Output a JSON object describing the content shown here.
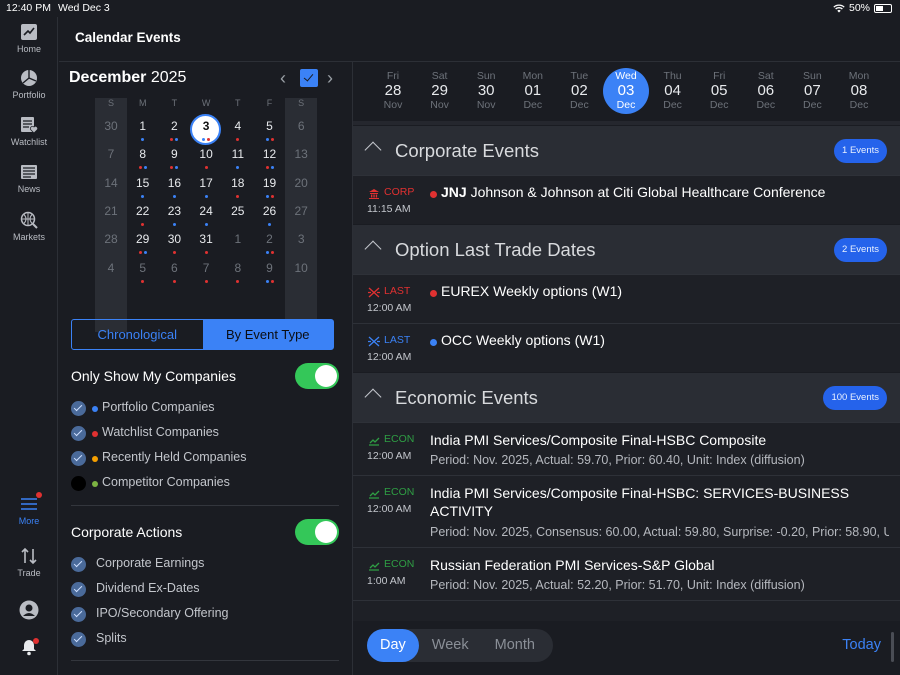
{
  "status": {
    "time": "12:40 PM",
    "date": "Wed Dec 3",
    "battery": "50%"
  },
  "nav": [
    {
      "label": "Home",
      "icon": "chart-icon"
    },
    {
      "label": "Portfolio",
      "icon": "pie-icon"
    },
    {
      "label": "Watchlist",
      "icon": "watchlist-icon"
    },
    {
      "label": "News",
      "icon": "news-icon"
    },
    {
      "label": "Markets",
      "icon": "globe-search-icon"
    },
    {
      "label": "More",
      "icon": "menu-icon"
    },
    {
      "label": "Trade",
      "icon": "trade-arrows-icon"
    }
  ],
  "header": {
    "title": "Calendar Events"
  },
  "calendar": {
    "month": "December",
    "year": "2025",
    "weekdays": [
      "S",
      "M",
      "T",
      "W",
      "T",
      "F",
      "S"
    ],
    "weeks": [
      [
        "30",
        "1",
        "2",
        "3",
        "4",
        "5",
        "6"
      ],
      [
        "7",
        "8",
        "9",
        "10",
        "11",
        "12",
        "13"
      ],
      [
        "14",
        "15",
        "16",
        "17",
        "18",
        "19",
        "20"
      ],
      [
        "21",
        "22",
        "23",
        "24",
        "25",
        "26",
        "27"
      ],
      [
        "28",
        "29",
        "30",
        "31",
        "1",
        "2",
        "3"
      ],
      [
        "4",
        "5",
        "6",
        "7",
        "8",
        "9",
        "10"
      ]
    ],
    "today": "3"
  },
  "view_toggle": {
    "chronological": "Chronological",
    "by_type": "By Event Type"
  },
  "filters": {
    "only_my_companies": "Only Show My Companies",
    "companies": [
      {
        "label": "Portfolio Companies",
        "color": "#3b82f6"
      },
      {
        "label": "Watchlist Companies",
        "color": "#e03131"
      },
      {
        "label": "Recently Held Companies",
        "color": "#f59f00"
      },
      {
        "label": "Competitor Companies",
        "color": "#7cb342"
      }
    ],
    "corporate_actions": "Corporate Actions",
    "actions": [
      "Corporate Earnings",
      "Dividend Ex-Dates",
      "IPO/Secondary Offering",
      "Splits"
    ]
  },
  "date_strip": [
    {
      "dow": "Fri",
      "day": "28",
      "mon": "Nov"
    },
    {
      "dow": "Sat",
      "day": "29",
      "mon": "Nov"
    },
    {
      "dow": "Sun",
      "day": "30",
      "mon": "Nov"
    },
    {
      "dow": "Mon",
      "day": "01",
      "mon": "Dec"
    },
    {
      "dow": "Tue",
      "day": "02",
      "mon": "Dec"
    },
    {
      "dow": "Wed",
      "day": "03",
      "mon": "Dec"
    },
    {
      "dow": "Thu",
      "day": "04",
      "mon": "Dec"
    },
    {
      "dow": "Fri",
      "day": "05",
      "mon": "Dec"
    },
    {
      "dow": "Sat",
      "day": "06",
      "mon": "Dec"
    },
    {
      "dow": "Sun",
      "day": "07",
      "mon": "Dec"
    },
    {
      "dow": "Mon",
      "day": "08",
      "mon": "Dec"
    }
  ],
  "sections": {
    "corporate": {
      "title": "Corporate Events",
      "count": "1 Events"
    },
    "option": {
      "title": "Option Last Trade Dates",
      "count": "2 Events"
    },
    "economic": {
      "title": "Economic Events",
      "count": "100 Events"
    }
  },
  "events": {
    "corp1": {
      "tag": "CORP",
      "time": "11:15 AM",
      "ticker": "JNJ",
      "title": "Johnson & Johnson at Citi Global Healthcare Conference"
    },
    "last1": {
      "tag": "LAST",
      "time": "12:00 AM",
      "title": "EUREX Weekly options (W1)"
    },
    "last2": {
      "tag": "LAST",
      "time": "12:00 AM",
      "title": "OCC Weekly options (W1)"
    },
    "econ1": {
      "tag": "ECON",
      "time": "12:00 AM",
      "title": "India PMI Services/Composite Final-HSBC Composite",
      "sub": "Period: Nov. 2025, Actual: 59.70, Prior: 60.40, Unit: Index (diffusion)"
    },
    "econ2": {
      "tag": "ECON",
      "time": "12:00 AM",
      "title": "India PMI Services/Composite Final-HSBC: SERVICES-BUSINESS ACTIVITY",
      "sub": "Period: Nov. 2025, Consensus: 60.00, Actual: 59.80, Surprise: -0.20, Prior: 58.90, U"
    },
    "econ3": {
      "tag": "ECON",
      "time": "1:00 AM",
      "title": "Russian Federation PMI Services-S&P Global",
      "sub": "Period: Nov. 2025, Actual: 52.20, Prior: 51.70, Unit: Index (diffusion)"
    }
  },
  "range": {
    "day": "Day",
    "week": "Week",
    "month": "Month",
    "today": "Today"
  },
  "colors": {
    "accent": "#3b82f6",
    "corp": "#e03131",
    "econ": "#2f9e44",
    "toggle_on": "#34c759"
  }
}
